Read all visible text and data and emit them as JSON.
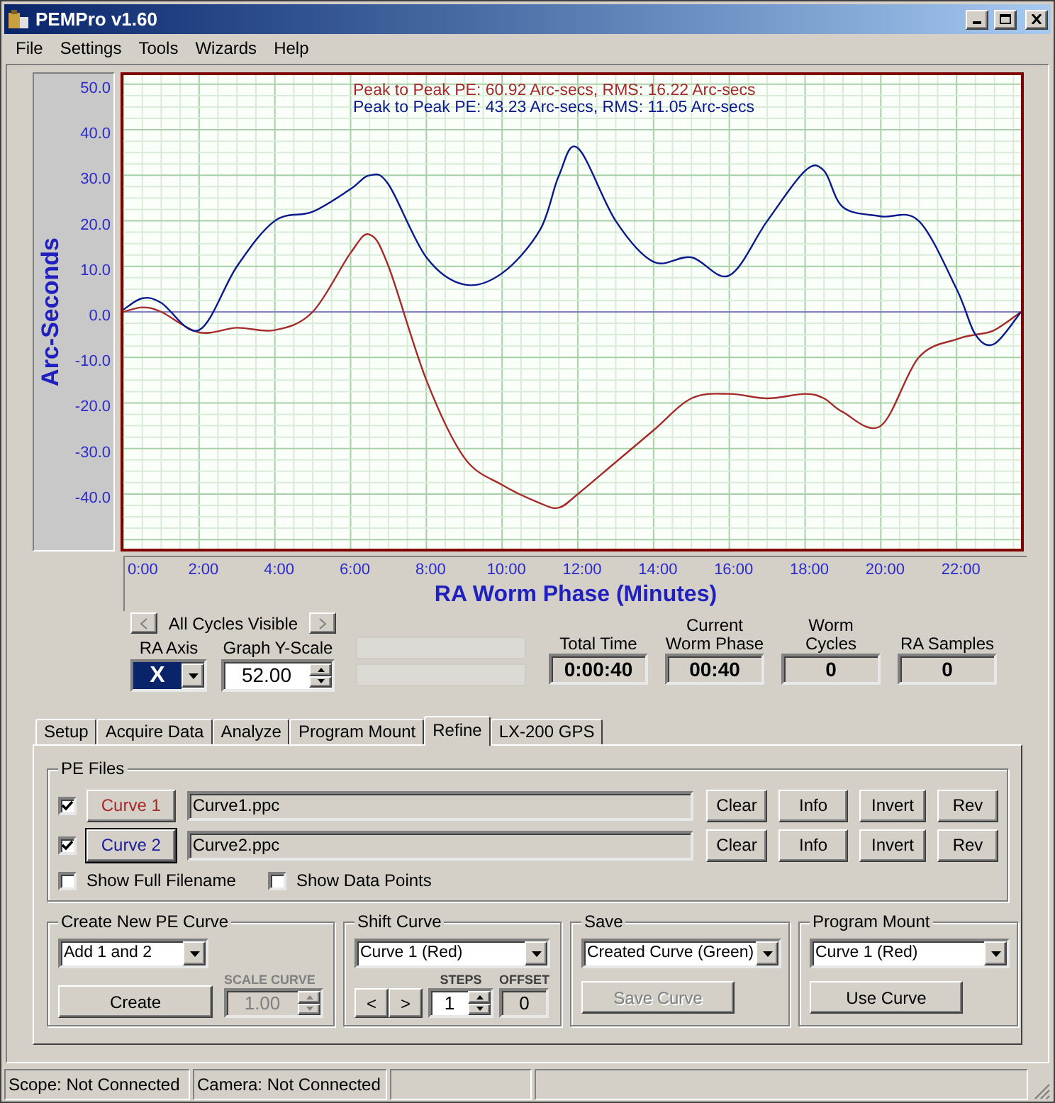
{
  "window": {
    "title": "PEMPro v1.60"
  },
  "menu": [
    "File",
    "Settings",
    "Tools",
    "Wizards",
    "Help"
  ],
  "chart": {
    "chart_data": {
      "type": "line",
      "xlabel": "RA Worm Phase (Minutes)",
      "ylabel": "Arc-Seconds",
      "x": [
        0,
        0.5,
        1,
        2,
        3,
        4,
        5,
        6,
        6.5,
        7,
        8,
        9,
        10,
        11,
        11.5,
        12,
        13,
        14,
        15,
        16,
        17,
        18,
        18.5,
        19,
        20,
        21,
        22,
        22.5,
        23,
        23.7
      ],
      "series": [
        {
          "color": "#a52a2a",
          "values": [
            0,
            1,
            0,
            -4.5,
            -3.5,
            -4,
            0,
            13,
            17,
            10,
            -15,
            -32,
            -38,
            -42,
            -43,
            -40,
            -33,
            -26,
            -19,
            -18,
            -19,
            -18,
            -19,
            -22,
            -25,
            -10,
            -6,
            -5,
            -4,
            0
          ]
        },
        {
          "color": "#0a1a8c",
          "values": [
            0.5,
            3,
            2,
            -4,
            10,
            20,
            22,
            27,
            30,
            28,
            12,
            6,
            8.5,
            18,
            30,
            36,
            20,
            11,
            12,
            8,
            20,
            31,
            31,
            23,
            21,
            20,
            5,
            -5,
            -7,
            0
          ]
        }
      ],
      "xlim": [
        0,
        23.7
      ],
      "ylim": [
        -52,
        52
      ],
      "grid": true,
      "ref_lines": [
        {
          "axis": "y",
          "value": 0,
          "color": "#8080c0"
        }
      ],
      "xticks": [
        {
          "value": 0,
          "label": "0:00"
        },
        {
          "value": 2,
          "label": "2:00"
        },
        {
          "value": 4,
          "label": "4:00"
        },
        {
          "value": 6,
          "label": "6:00"
        },
        {
          "value": 8,
          "label": "8:00"
        },
        {
          "value": 10,
          "label": "10:00"
        },
        {
          "value": 12,
          "label": "12:00"
        },
        {
          "value": 14,
          "label": "14:00"
        },
        {
          "value": 16,
          "label": "16:00"
        },
        {
          "value": 18,
          "label": "18:00"
        },
        {
          "value": 20,
          "label": "20:00"
        },
        {
          "value": 22,
          "label": "22:00"
        }
      ],
      "yticks": [
        {
          "value": 50,
          "label": "50.0"
        },
        {
          "value": 40,
          "label": "40.0"
        },
        {
          "value": 30,
          "label": "30.0"
        },
        {
          "value": 20,
          "label": "20.0"
        },
        {
          "value": 10,
          "label": "10.0"
        },
        {
          "value": 0,
          "label": "0.0"
        },
        {
          "value": -10,
          "label": "-10.0"
        },
        {
          "value": -20,
          "label": "-20.0"
        },
        {
          "value": -30,
          "label": "-30.0"
        },
        {
          "value": -40,
          "label": "-40.0"
        }
      ]
    },
    "stats": [
      {
        "text": "Peak to Peak PE: 60.92 Arc-secs,  RMS: 16.22 Arc-secs",
        "color": "#a52a2a"
      },
      {
        "text": "Peak to Peak PE: 43.23 Arc-secs,  RMS: 11.05 Arc-secs",
        "color": "#0a1a8c"
      }
    ]
  },
  "cycle_nav": {
    "label": "All Cycles Visible"
  },
  "ra_axis": {
    "label": "RA Axis",
    "value": "X"
  },
  "y_scale": {
    "label": "Graph Y-Scale",
    "value": "52.00"
  },
  "readouts": [
    {
      "label": "Total Time",
      "value": "0:00:40"
    },
    {
      "label": "Current Worm Phase",
      "value": "00:40"
    },
    {
      "label": "Worm Cycles",
      "value": "0"
    },
    {
      "label": "RA Samples",
      "value": "0"
    }
  ],
  "tabs": [
    {
      "label": "Setup",
      "selected": false
    },
    {
      "label": "Acquire Data",
      "selected": false
    },
    {
      "label": "Analyze",
      "selected": false
    },
    {
      "label": "Program Mount",
      "selected": false
    },
    {
      "label": "Refine",
      "selected": true
    },
    {
      "label": "LX-200 GPS",
      "selected": false
    }
  ],
  "pe_files": {
    "title": "PE Files",
    "rows": [
      {
        "checked": true,
        "button": "Curve 1",
        "color": "#a52a2a",
        "focused": false,
        "file": "Curve1.ppc",
        "actions": [
          "Clear",
          "Info",
          "Invert",
          "Rev"
        ]
      },
      {
        "checked": true,
        "button": "Curve 2",
        "color": "#1a1aa0",
        "focused": true,
        "file": "Curve2.ppc",
        "actions": [
          "Clear",
          "Info",
          "Invert",
          "Rev"
        ]
      }
    ],
    "options": [
      {
        "label": "Show Full Filename",
        "checked": false
      },
      {
        "label": "Show Data Points",
        "checked": false
      }
    ]
  },
  "create": {
    "title": "Create New PE Curve",
    "select": "Add 1 and  2",
    "button": "Create",
    "scale": {
      "label": "SCALE CURVE",
      "value": "1.00",
      "disabled": true
    }
  },
  "shift": {
    "title": "Shift Curve",
    "select": "Curve 1 (Red)",
    "prev": "<",
    "next": ">",
    "steps": {
      "label": "STEPS",
      "value": "1"
    },
    "offset": {
      "label": "OFFSET",
      "value": "0"
    }
  },
  "save": {
    "title": "Save",
    "select": "Created Curve (Green)",
    "button": {
      "label": "Save Curve",
      "disabled": true
    }
  },
  "program": {
    "title": "Program Mount",
    "select": "Curve 1 (Red)",
    "button": {
      "label": "Use Curve",
      "disabled": false
    }
  },
  "status_bar": [
    "Scope: Not Connected",
    "Camera: Not Connected"
  ]
}
